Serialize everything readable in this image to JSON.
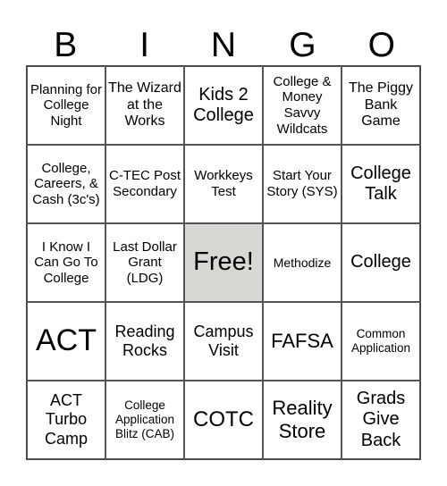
{
  "header": [
    "B",
    "I",
    "N",
    "G",
    "O"
  ],
  "cells": [
    [
      "Planning for College Night",
      "The Wizard at the Works",
      "Kids 2 College",
      "College & Money Savvy Wildcats",
      "The Piggy Bank Game"
    ],
    [
      "College, Careers, & Cash (3c's)",
      "C-TEC Post Secondary",
      "Workkeys Test",
      "Start Your Story (SYS)",
      "College Talk"
    ],
    [
      "I Know I Can Go To College",
      "Last Dollar Grant (LDG)",
      "Free!",
      "Methodize",
      "College"
    ],
    [
      "ACT",
      "Reading Rocks",
      "Campus Visit",
      "FAFSA",
      "Common Application"
    ],
    [
      "ACT Turbo Camp",
      "College Application Blitz (CAB)",
      "COTC",
      "Reality Store",
      "Grads Give Back"
    ]
  ],
  "free_cell_color": "#d8d7d4"
}
